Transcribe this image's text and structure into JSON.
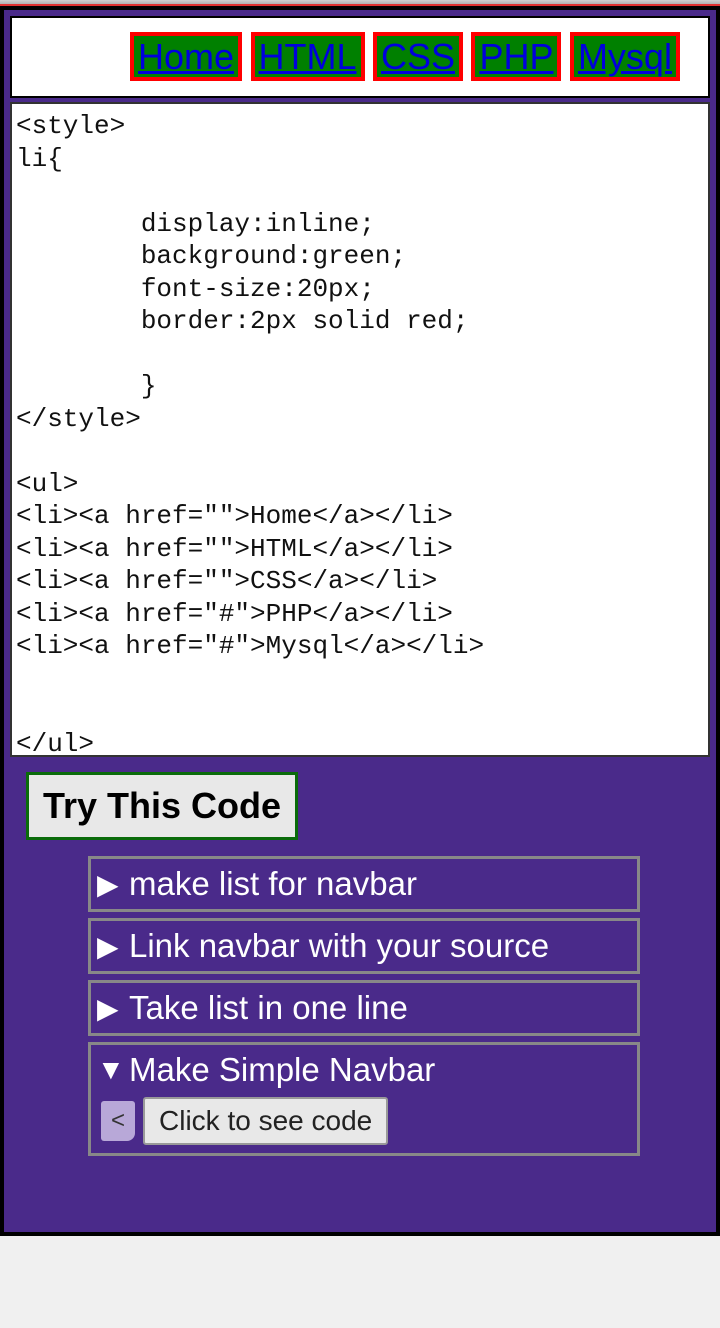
{
  "nav": {
    "items": [
      {
        "label": "Home"
      },
      {
        "label": "HTML"
      },
      {
        "label": "CSS"
      },
      {
        "label": "PHP"
      },
      {
        "label": "Mysql"
      }
    ]
  },
  "code": "<style>\nli{\n\n        display:inline;\n        background:green;\n        font-size:20px;\n        border:2px solid red;\n\n        }\n</style>\n\n<ul>\n<li><a href=\"\">Home</a></li>\n<li><a href=\"\">HTML</a></li>\n<li><a href=\"\">CSS</a></li>\n<li><a href=\"#\">PHP</a></li>\n<li><a href=\"#\">Mysql</a></li>\n\n\n</ul>",
  "try_button": "Try This Code",
  "accordion": {
    "items": [
      {
        "label": "make list for navbar",
        "expanded": false
      },
      {
        "label": "Link navbar with your source",
        "expanded": false
      },
      {
        "label": "Take list in one line",
        "expanded": false
      },
      {
        "label": "Make Simple Navbar",
        "expanded": true
      }
    ],
    "tag_badge": "<",
    "see_code_label": "Click to see code"
  }
}
